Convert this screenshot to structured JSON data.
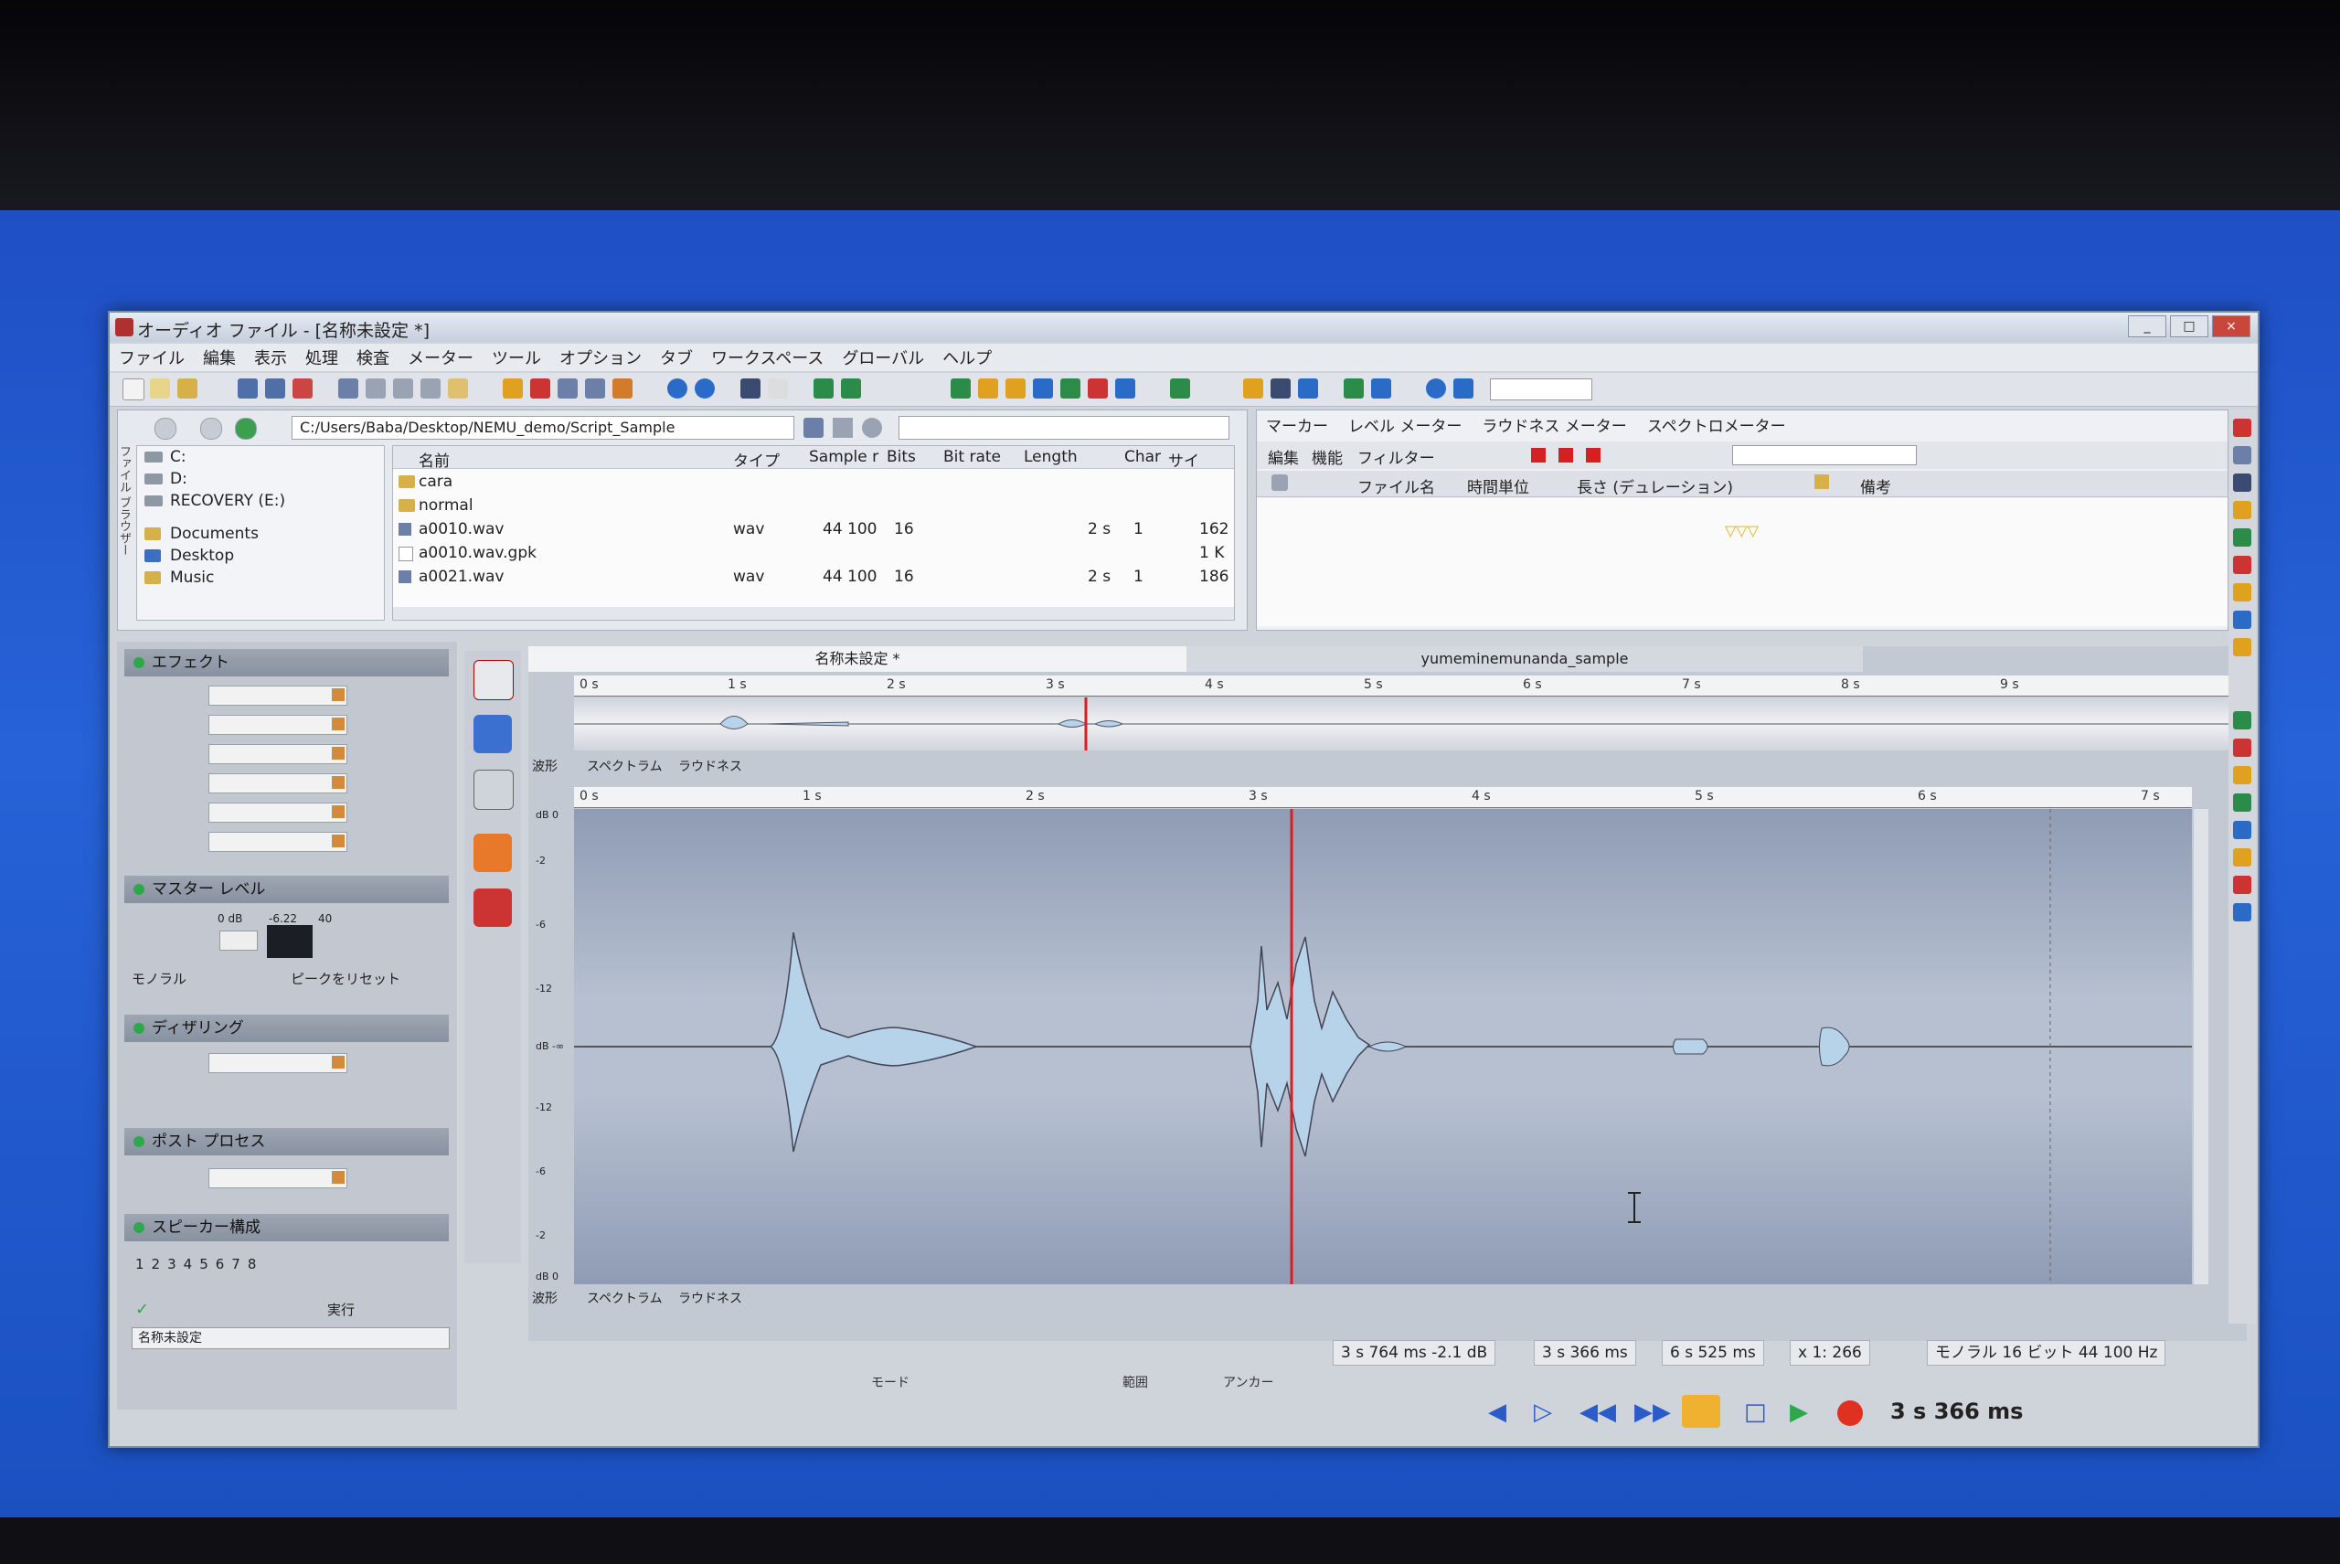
{
  "window": {
    "title": "オーディオ ファイル - [名称未設定 *]"
  },
  "menu": [
    "ファイル",
    "編集",
    "表示",
    "処理",
    "検査",
    "メーター",
    "ツール",
    "オプション",
    "タブ",
    "ワークスペース",
    "グローバル",
    "ヘルプ"
  ],
  "browser": {
    "path": "C:/Users/Baba/Desktop/NEMU_demo/Script_Sample",
    "side_label": "ファイル ブラウザー",
    "drives": [
      "C:",
      "D:",
      "RECOVERY (E:)"
    ],
    "places": [
      "Documents",
      "Desktop",
      "Music"
    ],
    "columns": [
      "名前",
      "タイプ",
      "Sample r",
      "Bits",
      "Bit rate",
      "Length",
      "Char",
      "サイ"
    ],
    "rows": [
      {
        "name": "cara",
        "type": "",
        "rate": "",
        "bits": "",
        "length": "",
        "ch": "",
        "size": ""
      },
      {
        "name": "normal",
        "type": "",
        "rate": "",
        "bits": "",
        "length": "",
        "ch": "",
        "size": ""
      },
      {
        "name": "a0010.wav",
        "type": "wav",
        "rate": "44 100",
        "bits": "16",
        "length": "2 s",
        "ch": "1",
        "size": "162"
      },
      {
        "name": "a0010.wav.gpk",
        "type": "",
        "rate": "",
        "bits": "",
        "length": "",
        "ch": "",
        "size": "1 K"
      },
      {
        "name": "a0021.wav",
        "type": "wav",
        "rate": "44 100",
        "bits": "16",
        "length": "2 s",
        "ch": "1",
        "size": "186"
      }
    ]
  },
  "markers": {
    "tabs": [
      "マーカー",
      "レベル メーター",
      "ラウドネス メーター",
      "スペクトロメーター"
    ],
    "toolbar": [
      "編集",
      "機能",
      "フィルター"
    ],
    "columns": [
      "ファイル名",
      "時間単位",
      "長さ (デュレーション)",
      "備考"
    ]
  },
  "left": {
    "effects": "エフェクト",
    "master": "マスター レベル",
    "master_vals": [
      "0 dB",
      "-6.22",
      "40"
    ],
    "mono": "モノラル",
    "peak_reset": "ピークをリセット",
    "dither": "ディザリング",
    "post": "ポスト プロセス",
    "speaker": "スピーカー構成",
    "speaker_nums": [
      "1",
      "2",
      "3",
      "4",
      "5",
      "6",
      "7",
      "8"
    ],
    "run": "実行",
    "preset": "名称未設定"
  },
  "editor": {
    "tab1": "名称未設定 *",
    "tab2": "yumeminemunanda_sample",
    "overview_ticks": [
      "0 s",
      "1 s",
      "2 s",
      "3 s",
      "4 s",
      "5 s",
      "6 s",
      "7 s",
      "8 s",
      "9 s"
    ],
    "main_ticks": [
      "0 s",
      "1 s",
      "2 s",
      "3 s",
      "4 s",
      "5 s",
      "6 s",
      "7 s"
    ],
    "view_tabs": [
      "波形",
      "スペクトラム",
      "ラウドネス"
    ],
    "db_labels": [
      "dB 0",
      "-2",
      "-6",
      "-12",
      "dB -∞",
      "-12",
      "-6",
      "-2",
      "dB 0"
    ]
  },
  "status": {
    "cursor": "3 s 764 ms",
    "level": "-2.1 dB",
    "position": "3 s 366 ms",
    "length": "6 s 525 ms",
    "zoom": "x 1: 266",
    "format": "モノラル 16 ビット 44 100 Hz"
  },
  "transport": {
    "mode_label": "モード",
    "range_label": "範囲",
    "anchor_label": "アンカー",
    "time": "3 s 366 ms"
  },
  "colors": {
    "accent": "#d42020",
    "wave": "#b7d3ea",
    "record": "#e03020"
  }
}
